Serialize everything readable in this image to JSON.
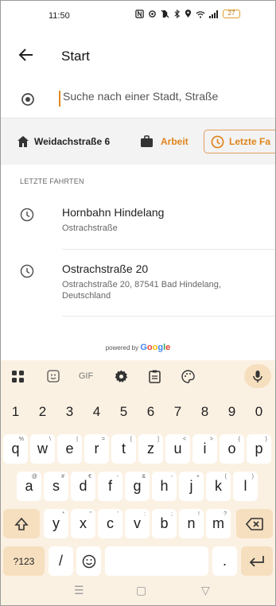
{
  "status_bar": {
    "time": "11:50",
    "battery": "27",
    "icons": [
      "nfc-icon",
      "vibrate-icon",
      "mute-icon",
      "bluetooth-icon",
      "location-icon",
      "wifi-icon",
      "signal-icon",
      "battery-icon"
    ]
  },
  "header": {
    "back_icon": "arrow-left-icon",
    "title": "Start"
  },
  "search": {
    "icon": "target-icon",
    "placeholder": "Suche nach einer Stadt, Straße",
    "value": ""
  },
  "quick_chips": [
    {
      "icon": "home-icon",
      "label": "Weidachstraße 6"
    },
    {
      "icon": "briefcase-icon",
      "label": "Arbeit"
    },
    {
      "icon": "clock-icon",
      "label": "Letzte Fa"
    }
  ],
  "recent": {
    "section_label": "LETZTE FAHRTEN",
    "items": [
      {
        "icon": "clock-icon",
        "title": "Hornbahn Hindelang",
        "subtitle": "Ostrachstraße"
      },
      {
        "icon": "clock-icon",
        "title": "Ostrachstraße 20",
        "subtitle": "Ostrachstraße 20, 87541 Bad Hindelang, Deutschland"
      }
    ]
  },
  "attribution": {
    "prefix": "powered by",
    "brand": "Google"
  },
  "keyboard": {
    "toolbar": [
      "apps-icon",
      "sticker-icon",
      "GIF",
      "gear-icon",
      "clipboard-icon",
      "palette-icon",
      "mic-icon"
    ],
    "row_numbers": [
      "1",
      "2",
      "3",
      "4",
      "5",
      "6",
      "7",
      "8",
      "9",
      "0"
    ],
    "row1": [
      {
        "k": "q",
        "s": "%"
      },
      {
        "k": "w",
        "s": "\\"
      },
      {
        "k": "e",
        "s": "|"
      },
      {
        "k": "r",
        "s": "="
      },
      {
        "k": "t",
        "s": "["
      },
      {
        "k": "z",
        "s": "]"
      },
      {
        "k": "u",
        "s": "<"
      },
      {
        "k": "i",
        "s": ">"
      },
      {
        "k": "o",
        "s": "{"
      },
      {
        "k": "p",
        "s": "}"
      }
    ],
    "row2": [
      {
        "k": "a",
        "s": "@"
      },
      {
        "k": "s",
        "s": "#"
      },
      {
        "k": "d",
        "s": "€"
      },
      {
        "k": "f",
        "s": "-"
      },
      {
        "k": "g",
        "s": "&"
      },
      {
        "k": "h",
        "s": "-"
      },
      {
        "k": "j",
        "s": "+"
      },
      {
        "k": "k",
        "s": "("
      },
      {
        "k": "l",
        "s": ")"
      }
    ],
    "row3": [
      {
        "k": "y",
        "s": "*"
      },
      {
        "k": "x",
        "s": "\""
      },
      {
        "k": "c",
        "s": "'"
      },
      {
        "k": "v",
        "s": ":"
      },
      {
        "k": "b",
        "s": ";"
      },
      {
        "k": "n",
        "s": "!"
      },
      {
        "k": "m",
        "s": "?"
      }
    ],
    "bottom": {
      "symbols": "?123",
      "slash": "/",
      "period": "."
    }
  },
  "colors": {
    "accent": "#e0841c",
    "keyboard_bg": "#fbf1e3",
    "function_key": "#f6dfbf"
  }
}
